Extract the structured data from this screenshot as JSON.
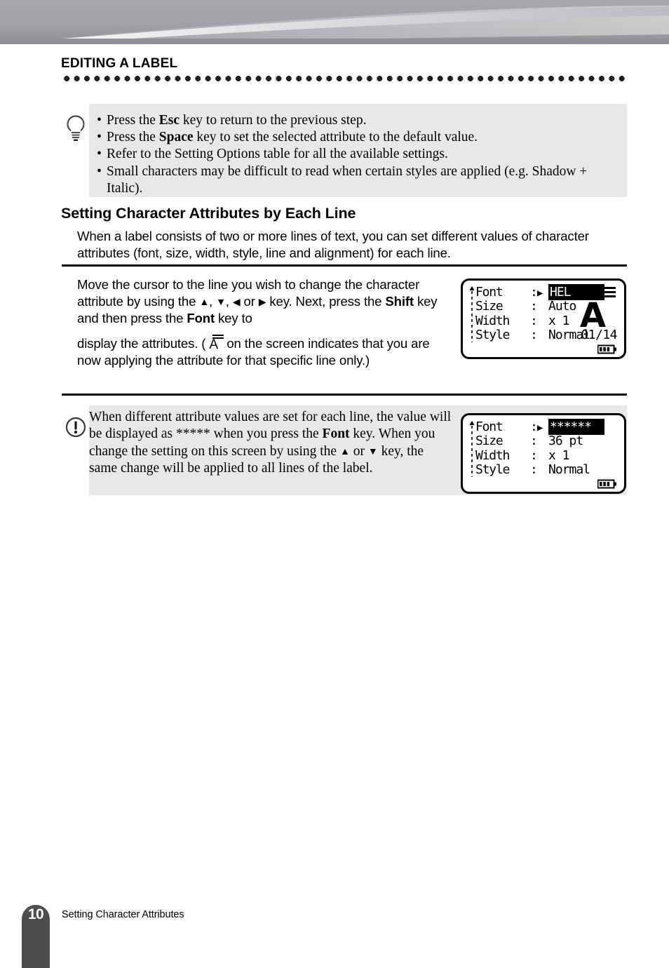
{
  "header": {
    "chapter_title": "EDITING A LABEL"
  },
  "tip_box": {
    "icon": "lightbulb-icon",
    "bullets": [
      {
        "pre": "Press the ",
        "bold": "Esc",
        "post": " key to return to the previous step."
      },
      {
        "pre": "Press the ",
        "bold": "Space",
        "post": " key to set the selected attribute to the default value."
      },
      {
        "pre": "Refer to the Setting Options table for all the available settings.",
        "bold": "",
        "post": ""
      },
      {
        "pre": "Small characters may be difficult to read when certain styles are applied (e.g. Shadow + Italic).",
        "bold": "",
        "post": ""
      }
    ]
  },
  "section": {
    "heading": "Setting Character Attributes by Each Line",
    "intro": "When a label consists of two or more lines of text, you can set different values of character attributes (font, size, width, style, line and alignment) for each line."
  },
  "step": {
    "part1_a": "Move the cursor to the line you wish to change the character attribute by using the ",
    "arrow_up": "▲",
    "sep1": ", ",
    "arrow_down": "▼",
    "sep2": ", ",
    "arrow_left": "◀",
    "sep3": " or ",
    "arrow_right": "▶",
    "part1_b": " key. Next, press the ",
    "bold_shift": "Shift",
    "part1_c": " key and then press the ",
    "bold_font": "Font",
    "part1_d": " key to",
    "part2_a": "display the attributes. ( ",
    "glyph": "A",
    "part2_b": " on the screen indicates that you are now applying the attribute for that specific line only.)"
  },
  "lcd1": {
    "name": "lcd-screen-font-hel",
    "rows": [
      {
        "label": "Font",
        "sep": ":",
        "value": "HEL",
        "inverted": true,
        "marker": "▶"
      },
      {
        "label": "Size",
        "sep": ":",
        "value": "Auto",
        "inverted": false,
        "marker": ""
      },
      {
        "label": "Width",
        "sep": ":",
        "value": "x 1",
        "inverted": false,
        "marker": ""
      },
      {
        "label": "Style",
        "sep": ":",
        "value": "Normal",
        "inverted": false,
        "marker": ""
      }
    ],
    "big_glyph": "A",
    "counter": "01/14",
    "indicator": "three-bars-icon",
    "battery": "battery-icon"
  },
  "lcd2": {
    "name": "lcd-screen-font-asterisks",
    "rows": [
      {
        "label": "Font",
        "sep": ":",
        "value": "******",
        "inverted": true,
        "marker": "▶"
      },
      {
        "label": "Size",
        "sep": ":",
        "value": "36 pt",
        "inverted": false,
        "marker": ""
      },
      {
        "label": "Width",
        "sep": ":",
        "value": "x 1",
        "inverted": false,
        "marker": ""
      },
      {
        "label": "Style",
        "sep": ":",
        "value": "Normal",
        "inverted": false,
        "marker": ""
      }
    ],
    "battery": "battery-icon"
  },
  "note_box": {
    "icon": "warning-exclamation-icon",
    "part_a": "When different attribute values are set for each line, the value will be displayed as ***** when you press the ",
    "bold_font": "Font",
    "part_b": " key. When you change the setting on this screen by using the ",
    "arrow_up": "▲",
    "part_c": " or ",
    "arrow_down": "▼",
    "part_d": " key, the same change will be applied to all lines of the label."
  },
  "footer": {
    "page_number": "10",
    "text": "Setting Character Attributes"
  },
  "colors": {
    "box_bg": "#e8e8e8",
    "footer_tab": "#4d4d4d",
    "rule": "#000000",
    "banner_dark": "#a0a2a5",
    "banner_light": "#f2f2f2"
  }
}
